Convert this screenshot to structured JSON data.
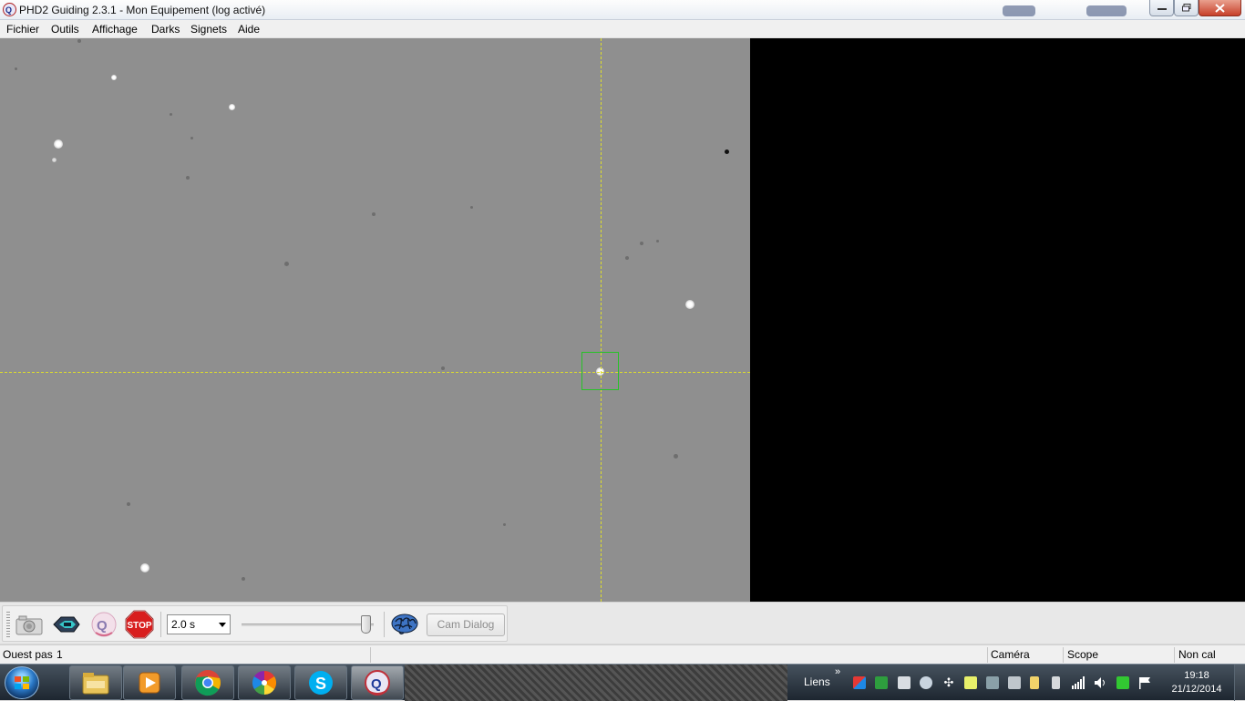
{
  "window": {
    "title": "PHD2 Guiding 2.3.1 - Mon Equipement (log activé)"
  },
  "menubar": {
    "items": [
      "Fichier",
      "Outils",
      "Affichage",
      "Darks",
      "Signets",
      "Aide"
    ]
  },
  "toolbar": {
    "loop_icon": "camera-icon",
    "connect_icon": "gear-connect-icon",
    "guide_icon": "phd-guide-icon",
    "stop_label": "STOP",
    "exposure_value": "2.0 s",
    "brain_icon": "brain-icon",
    "cam_dialog_label": "Cam Dialog"
  },
  "statusbar": {
    "message_label": "Ouest pas",
    "message_value": "1",
    "camera": "Caméra",
    "scope": "Scope",
    "calibration": "Non cal"
  },
  "taskbar": {
    "links_label": "Liens",
    "links_chevron": "»",
    "time": "19:18",
    "date": "21/12/2014",
    "apps": [
      "explorer-icon",
      "media-player-icon",
      "chrome-icon",
      "picasa-icon",
      "skype-icon",
      "phd2-icon"
    ]
  },
  "colors": {
    "image_background": "#8f8f8f",
    "crosshair": "#dede2c",
    "guide_box": "#27c227",
    "stop_red": "#d81e1e"
  }
}
